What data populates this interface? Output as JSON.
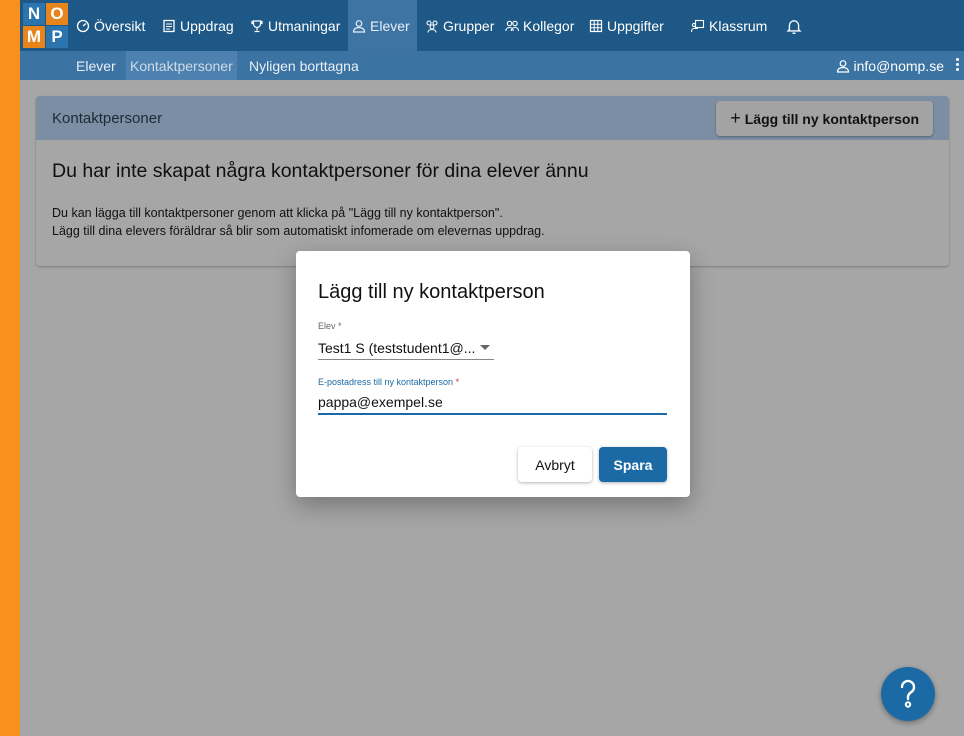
{
  "logo": {
    "letters": [
      "N",
      "O",
      "M",
      "P"
    ]
  },
  "nav": {
    "items": [
      {
        "label": "Översikt",
        "icon": "dashboard-icon"
      },
      {
        "label": "Uppdrag",
        "icon": "assignment-icon"
      },
      {
        "label": "Utmaningar",
        "icon": "trophy-icon"
      },
      {
        "label": "Elever",
        "icon": "person-icon"
      },
      {
        "label": "Grupper",
        "icon": "group-icon"
      },
      {
        "label": "Kollegor",
        "icon": "colleagues-icon"
      },
      {
        "label": "Uppgifter",
        "icon": "grid-icon"
      },
      {
        "label": "Klassrum",
        "icon": "classroom-icon"
      }
    ],
    "active": "Elever",
    "bell_icon": "bell-icon"
  },
  "subnav": {
    "items": [
      {
        "label": "Elever"
      },
      {
        "label": "Kontaktpersoner"
      },
      {
        "label": "Nyligen borttagna"
      }
    ],
    "active": "Kontaktpersoner",
    "user_email": "info@nomp.se"
  },
  "card": {
    "title": "Kontaktpersoner",
    "add_button": "Lägg till ny kontaktperson",
    "heading": "Du har inte skapat några kontaktpersoner för dina elever ännu",
    "text_line1": "Du kan lägga till kontaktpersoner genom att klicka på \"Lägg till ny kontaktperson\".",
    "text_line2": "Lägg till dina elevers föräldrar så blir som automatiskt infomerade om elevernas uppdrag."
  },
  "modal": {
    "title": "Lägg till ny kontaktperson",
    "student_label": "Elev",
    "student_value": "Test1 S (teststudent1@...",
    "email_label": "E-postadress till ny kontaktperson",
    "email_value": "pappa@exempel.se",
    "required_mark": "*",
    "cancel": "Avbryt",
    "save": "Spara"
  },
  "colors": {
    "primary": "#1b6aa5",
    "nav": "#1d5886",
    "subnav": "#3b73a3",
    "frame": "#f7901e"
  }
}
